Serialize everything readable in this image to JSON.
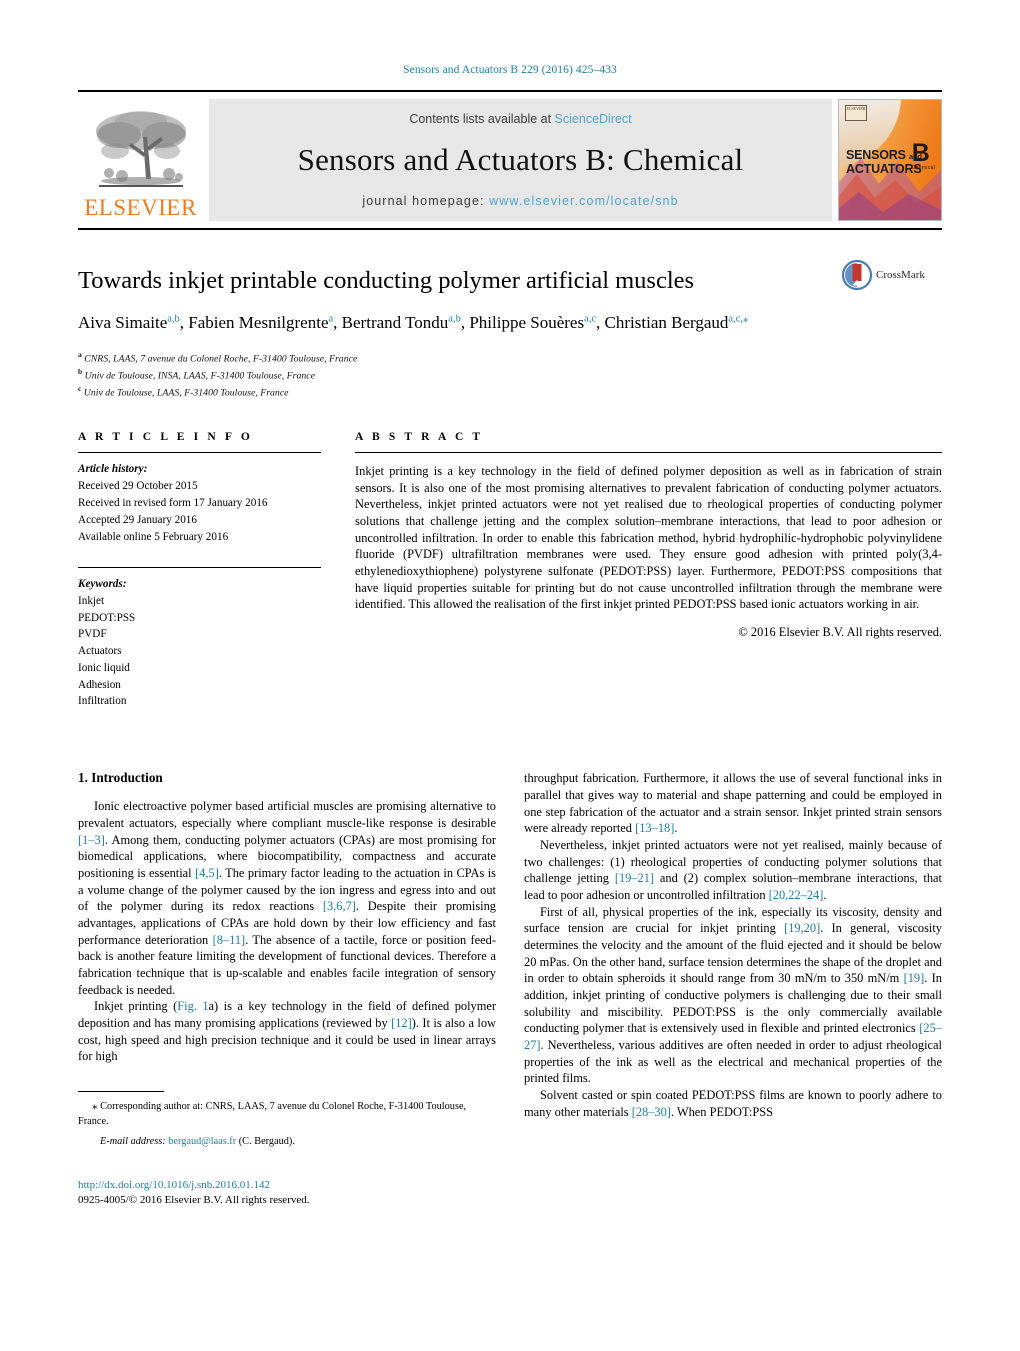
{
  "running_head": "Sensors and Actuators B 229 (2016) 425–433",
  "banner": {
    "publisher": "ELSEVIER",
    "contents_prefix": "Contents lists available at ",
    "contents_link": "ScienceDirect",
    "journal_name": "Sensors and Actuators B: Chemical",
    "homepage_prefix": "journal homepage: ",
    "homepage_url": "www.elsevier.com/locate/snb",
    "cover": {
      "line1": "SENSORS",
      "and": "and",
      "line2": "ACTUATORS",
      "letter": "B",
      "letter_sub": "Chemical",
      "publisher_mark": "ELSEVIER"
    }
  },
  "article": {
    "title": "Towards inkjet printable conducting polymer artificial muscles",
    "authors": [
      {
        "name": "Aiva Simaite",
        "sup": "a,b",
        "sep": ", "
      },
      {
        "name": "Fabien Mesnilgrente",
        "sup": "a",
        "sep": ", "
      },
      {
        "name": "Bertrand Tondu",
        "sup": "a,b",
        "sep": ", "
      },
      {
        "name": "Philippe Souères",
        "sup": "a,c",
        "sep": ", "
      },
      {
        "name": "Christian Bergaud",
        "sup": "a,c,⁎",
        "sep": ""
      }
    ],
    "affiliations": [
      {
        "mark": "a",
        "text": "CNRS, LAAS, 7 avenue du Colonel Roche, F-31400 Toulouse, France"
      },
      {
        "mark": "b",
        "text": "Univ de Toulouse, INSA, LAAS, F-31400 Toulouse, France"
      },
      {
        "mark": "c",
        "text": "Univ de Toulouse, LAAS, F-31400 Toulouse, France"
      }
    ],
    "crossmark_label": "CrossMark"
  },
  "article_info": {
    "heading": "A R T I C L E   I N F O",
    "history_label": "Article history:",
    "history": [
      "Received 29 October 2015",
      "Received in revised form 17 January 2016",
      "Accepted 29 January 2016",
      "Available online 5 February 2016"
    ],
    "keywords_label": "Keywords:",
    "keywords": [
      "Inkjet",
      "PEDOT:PSS",
      "PVDF",
      "Actuators",
      "Ionic liquid",
      "Adhesion",
      "Infiltration"
    ]
  },
  "abstract": {
    "heading": "A B S T R A C T",
    "text": "Inkjet printing is a key technology in the field of defined polymer deposition as well as in fabrication of strain sensors. It is also one of the most promising alternatives to prevalent fabrication of conducting polymer actuators. Nevertheless, inkjet printed actuators were not yet realised due to rheological properties of conducting polymer solutions that challenge jetting and the complex solution–membrane interactions, that lead to poor adhesion or uncontrolled infiltration. In order to enable this fabrication method, hybrid hydrophilic-hydrophobic polyvinylidene fluoride (PVDF) ultrafiltration membranes were used. They ensure good adhesion with printed poly(3,4-ethylenedioxythiophene) polystyrene sulfonate (PEDOT:PSS) layer. Furthermore, PEDOT:PSS compositions that have liquid properties suitable for printing but do not cause uncontrolled infiltration through the membrane were identified. This allowed the realisation of the first inkjet printed PEDOT:PSS based ionic actuators working in air.",
    "copyright": "© 2016 Elsevier B.V. All rights reserved."
  },
  "body": {
    "section_number_title": "1.  Introduction",
    "left_paragraphs": [
      [
        {
          "t": "Ionic electroactive polymer based artificial muscles are promising alternative to prevalent actuators, especially where compliant muscle-like response is desirable "
        },
        {
          "t": "[1–3]",
          "ref": true
        },
        {
          "t": ". Among them, conducting polymer actuators (CPAs) are most promising for biomedical applications, where biocompatibility, compactness and accurate positioning is essential "
        },
        {
          "t": "[4,5]",
          "ref": true
        },
        {
          "t": ". The primary factor leading to the actuation in CPAs is a volume change of the polymer caused by the ion ingress and egress into and out of the polymer during its redox reactions "
        },
        {
          "t": "[3,6,7]",
          "ref": true
        },
        {
          "t": ". Despite their promising advantages, applications of CPAs are hold down by their low efficiency and fast performance deterioration "
        },
        {
          "t": "[8–11]",
          "ref": true
        },
        {
          "t": ". The absence of a tactile, force or position feed-back is another feature limiting the development of functional devices. Therefore a fabrication technique that is up-scalable and enables facile integration of sensory feedback is needed."
        }
      ],
      [
        {
          "t": "Inkjet printing ("
        },
        {
          "t": "Fig. 1",
          "ref": true
        },
        {
          "t": "a) is a key technology in the field of defined polymer deposition and has many promising applications (reviewed by "
        },
        {
          "t": "[12]",
          "ref": true
        },
        {
          "t": "). It is also a low cost, high speed and high precision technique and it could be used in linear arrays for high"
        }
      ]
    ],
    "right_paragraphs": [
      [
        {
          "t": "throughput fabrication. Furthermore, it allows the use of several functional inks in parallel that gives way to material and shape patterning and could be employed in one step fabrication of the actuator and a strain sensor. Inkjet printed strain sensors were already reported "
        },
        {
          "t": "[13–18]",
          "ref": true
        },
        {
          "t": "."
        }
      ],
      [
        {
          "t": "Nevertheless, inkjet printed actuators were not yet realised, mainly because of two challenges: (1) rheological properties of conducting polymer solutions that challenge jetting "
        },
        {
          "t": "[19–21]",
          "ref": true
        },
        {
          "t": " and (2) complex solution–membrane interactions, that lead to poor adhesion or uncontrolled infiltration "
        },
        {
          "t": "[20,22–24]",
          "ref": true
        },
        {
          "t": "."
        }
      ],
      [
        {
          "t": "First of all, physical properties of the ink, especially its viscosity, density and surface tension are crucial for inkjet printing "
        },
        {
          "t": "[19,20]",
          "ref": true
        },
        {
          "t": ". In general, viscosity determines the velocity and the amount of the fluid ejected and it should be below 20 mPas. On the other hand, surface tension determines the shape of the droplet and in order to obtain spheroids it should range from 30 mN/m to 350 mN/m "
        },
        {
          "t": "[19]",
          "ref": true
        },
        {
          "t": ". In addition, inkjet printing of conductive polymers is challenging due to their small solubility and miscibility. PEDOT:PSS is the only commercially available conducting polymer that is extensively used in flexible and printed electronics "
        },
        {
          "t": "[25–27]",
          "ref": true
        },
        {
          "t": ". Nevertheless, various additives are often needed in order to adjust rheological properties of the ink as well as the electrical and mechanical properties of the printed films."
        }
      ],
      [
        {
          "t": "Solvent casted or spin coated PEDOT:PSS films are known to poorly adhere to many other materials "
        },
        {
          "t": "[28–30]",
          "ref": true
        },
        {
          "t": ". When PEDOT:PSS"
        }
      ]
    ]
  },
  "footer": {
    "corresponding_star": "⁎",
    "corresponding_text": "Corresponding author at: CNRS, LAAS, 7 avenue du Colonel Roche, F-31400 Toulouse, France.",
    "email_label": "E-mail address:",
    "email": "bergaud@laas.fr",
    "email_owner": "(C. Bergaud).",
    "doi": "http://dx.doi.org/10.1016/j.snb.2016.01.142",
    "issn_line": "0925-4005/© 2016 Elsevier B.V. All rights reserved."
  },
  "colors": {
    "link": "#1a7fa8",
    "sciencedirect": "#4da6d4",
    "elsevier_orange": "#f07c1e",
    "banner_bg": "#e7e7e7"
  }
}
